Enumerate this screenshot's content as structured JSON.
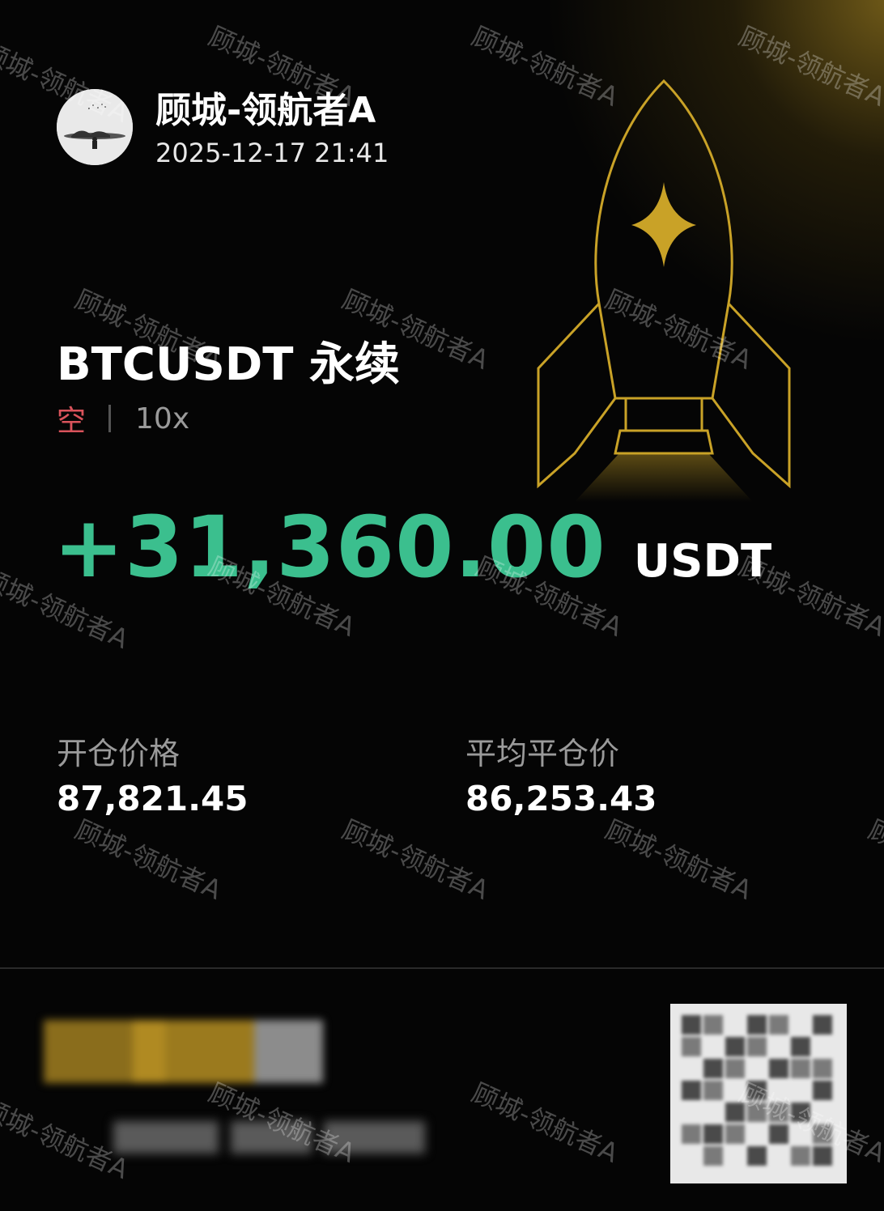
{
  "user": {
    "name": "顾城-领航者A",
    "timestamp": "2025-12-17 21:41"
  },
  "position": {
    "symbol": "BTCUSDT 永续",
    "side": "空",
    "leverage": "10x",
    "pnl": "+31,360.00",
    "pnl_unit": "USDT"
  },
  "prices": {
    "entry_label": "开仓价格",
    "entry_value": "87,821.45",
    "close_label": "平均平仓价",
    "close_value": "86,253.43"
  },
  "watermark": {
    "text": "顾城-领航者A"
  },
  "colors": {
    "profit": "#3bbf8e",
    "short": "#d9535b",
    "accent_gold": "#c9a227",
    "background": "#050505"
  },
  "icons": {
    "rocket": "rocket-icon",
    "star": "four-point-star-icon",
    "qr": "qr-code-icon"
  }
}
